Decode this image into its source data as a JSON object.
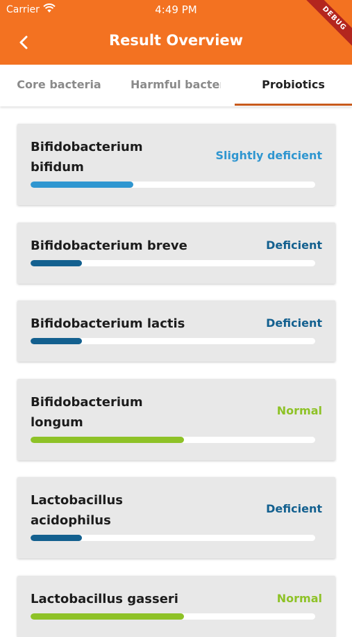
{
  "status_bar": {
    "carrier": "Carrier",
    "time": "4:49 PM"
  },
  "app_bar": {
    "title": "Result Overview",
    "debug_label": "DEBUG"
  },
  "tabs": [
    {
      "label": "Core bacteria"
    },
    {
      "label": "Harmful bacteria"
    },
    {
      "label": "Probiotics"
    }
  ],
  "colors": {
    "accent": "#f37221",
    "slightly_deficient": "#2f96d0",
    "deficient": "#13608f",
    "normal": "#8ec227"
  },
  "results": [
    {
      "name": "Bifidobacterium bifidum",
      "status": "Slightly deficient",
      "level": 0.36,
      "color": "#2f96d0"
    },
    {
      "name": "Bifidobacterium breve",
      "status": "Deficient",
      "level": 0.18,
      "color": "#13608f"
    },
    {
      "name": "Bifidobacterium lactis",
      "status": "Deficient",
      "level": 0.18,
      "color": "#13608f"
    },
    {
      "name": "Bifidobacterium longum",
      "status": "Normal",
      "level": 0.54,
      "color": "#8ec227"
    },
    {
      "name": "Lactobacillus acidophilus",
      "status": "Deficient",
      "level": 0.18,
      "color": "#13608f"
    },
    {
      "name": "Lactobacillus gasseri",
      "status": "Normal",
      "level": 0.54,
      "color": "#8ec227"
    }
  ]
}
